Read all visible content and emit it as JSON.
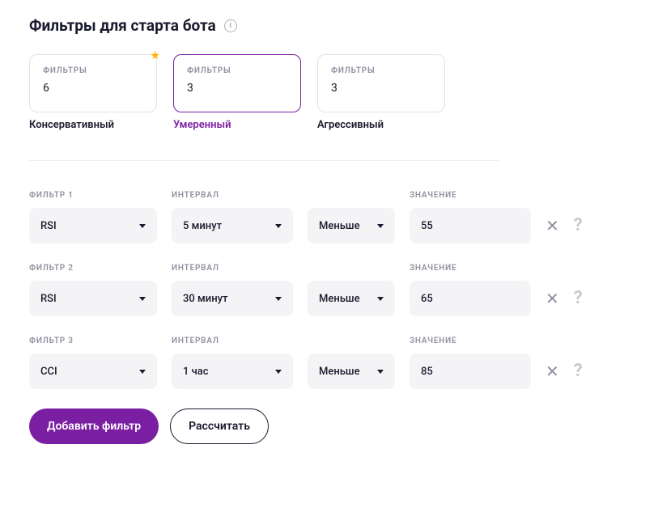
{
  "header": {
    "title": "Фильтры для старта бота"
  },
  "presets": {
    "filters_label": "ФИЛЬТРЫ",
    "items": [
      {
        "count": "6",
        "name": "Консервативный",
        "starred": true,
        "active": false
      },
      {
        "count": "3",
        "name": "Умеренный",
        "starred": false,
        "active": true
      },
      {
        "count": "3",
        "name": "Агрессивный",
        "starred": false,
        "active": false
      }
    ]
  },
  "columns": {
    "filter": "ФИЛЬТР",
    "interval": "ИНТЕРВАЛ",
    "value": "ЗНАЧЕНИЕ"
  },
  "filters": [
    {
      "label": "ФИЛЬТР 1",
      "indicator": "RSI",
      "interval": "5 минут",
      "condition": "Меньше",
      "value": "55"
    },
    {
      "label": "ФИЛЬТР 2",
      "indicator": "RSI",
      "interval": "30 минут",
      "condition": "Меньше",
      "value": "65"
    },
    {
      "label": "ФИЛЬТР 3",
      "indicator": "CCI",
      "interval": "1 час",
      "condition": "Меньше",
      "value": "85"
    }
  ],
  "actions": {
    "add": "Добавить фильтр",
    "calculate": "Рассчитать"
  }
}
